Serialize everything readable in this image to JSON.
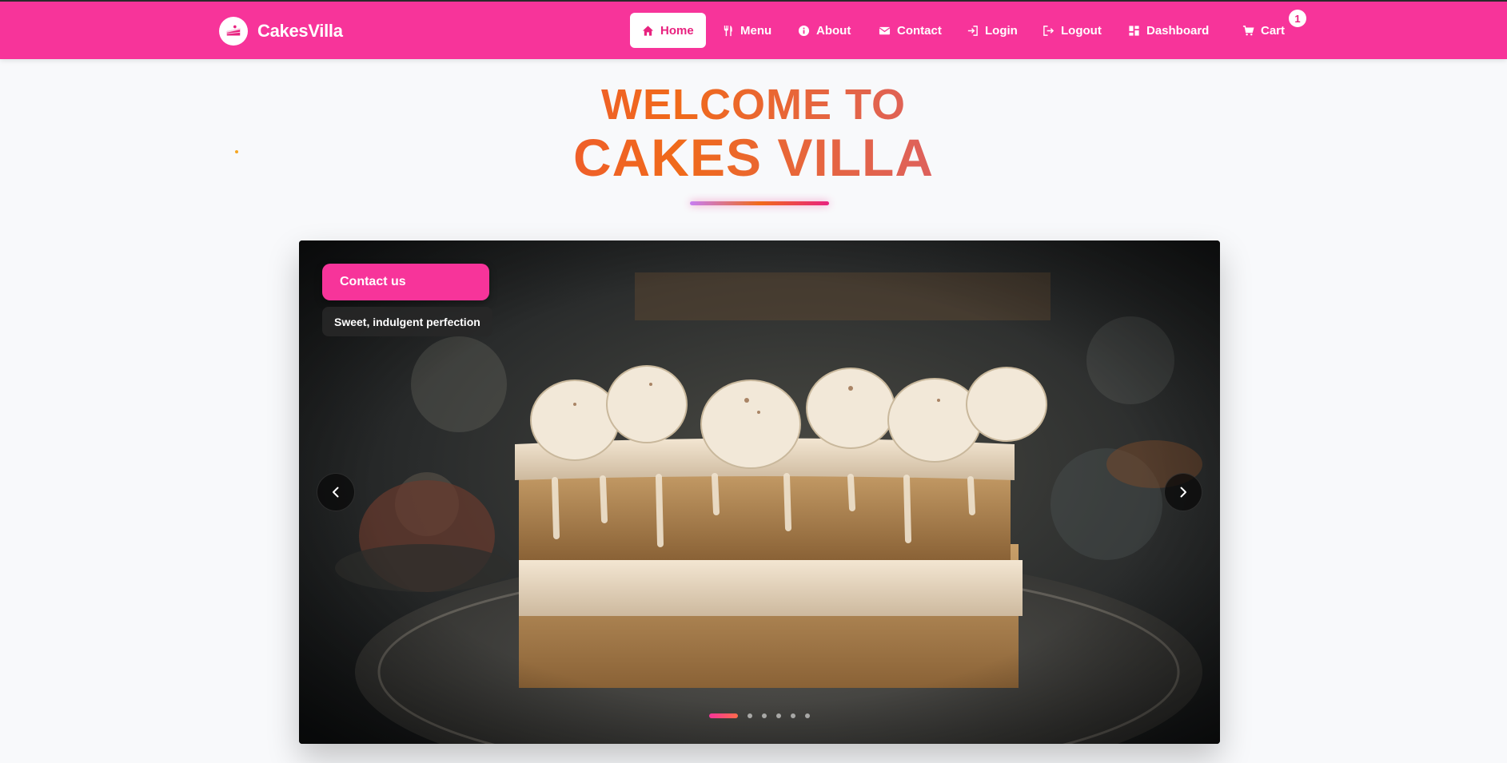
{
  "brand": {
    "name": "CakesVilla",
    "logo_icon": "cake-icon"
  },
  "nav": {
    "items": [
      {
        "label": "Home",
        "icon": "home-icon",
        "active": true
      },
      {
        "label": "Menu",
        "icon": "utensils-icon"
      },
      {
        "label": "About",
        "icon": "info-icon"
      },
      {
        "label": "Contact",
        "icon": "envelope-icon"
      },
      {
        "label": "Login",
        "icon": "sign-in-icon"
      },
      {
        "label": "Logout",
        "icon": "sign-out-icon"
      },
      {
        "label": "Dashboard",
        "icon": "dashboard-icon"
      },
      {
        "label": "Cart",
        "icon": "cart-icon"
      }
    ],
    "cart_count": "1"
  },
  "hero": {
    "line1": "WELCOME TO",
    "line2": "CAKES VILLA"
  },
  "carousel": {
    "contact_button": "Contact us",
    "tagline": "Sweet, indulgent perfection",
    "slide_count": 6,
    "active_slide": 1,
    "image": "layered-cream-cake-photo"
  },
  "colors": {
    "primary": "#f7349a",
    "accent_pink": "#e8227f",
    "accent_orange": "#f06a1a",
    "accent_purple": "#b54cf2",
    "background": "#f8f9fb"
  }
}
